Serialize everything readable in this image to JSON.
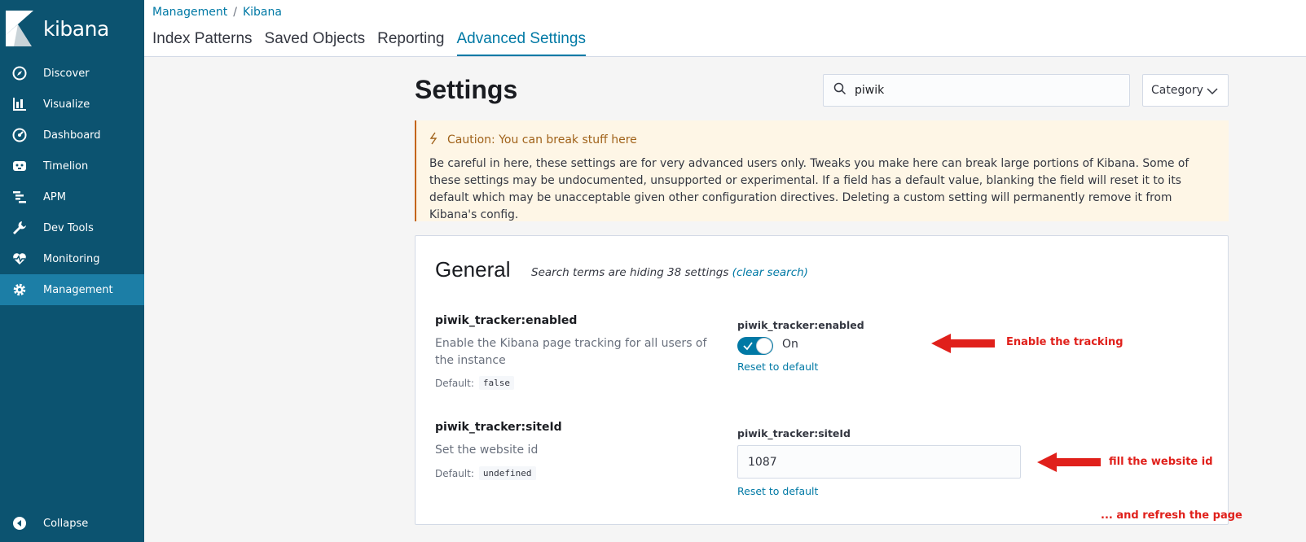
{
  "sidebar": {
    "brand": "kibana",
    "items": [
      {
        "label": "Discover",
        "icon": "compass-icon"
      },
      {
        "label": "Visualize",
        "icon": "bar-chart-icon"
      },
      {
        "label": "Dashboard",
        "icon": "dashboard-icon"
      },
      {
        "label": "Timelion",
        "icon": "timelion-icon"
      },
      {
        "label": "APM",
        "icon": "apm-icon"
      },
      {
        "label": "Dev Tools",
        "icon": "wrench-icon"
      },
      {
        "label": "Monitoring",
        "icon": "heartbeat-icon"
      },
      {
        "label": "Management",
        "icon": "gear-icon",
        "active": true
      }
    ],
    "collapse_label": "Collapse"
  },
  "header": {
    "breadcrumbs": [
      "Management",
      "Kibana"
    ],
    "tabs": [
      {
        "label": "Index Patterns"
      },
      {
        "label": "Saved Objects"
      },
      {
        "label": "Reporting"
      },
      {
        "label": "Advanced Settings",
        "selected": true
      }
    ]
  },
  "main": {
    "title": "Settings",
    "search": {
      "value": "piwik"
    },
    "category_label": "Category",
    "callout": {
      "title": "Caution: You can break stuff here",
      "body": "Be careful in here, these settings are for very advanced users only. Tweaks you make here can break large portions of Kibana. Some of these settings may be undocumented, unsupported or experimental. If a field has a default value, blanking the field will reset it to its default which may be unacceptable given other configuration directives. Deleting a custom setting will permanently remove it from Kibana's config."
    },
    "panel": {
      "title": "General",
      "hint": "Search terms are hiding 38 settings",
      "clear_search": "(clear search)",
      "settings": [
        {
          "name": "piwik_tracker:enabled",
          "description": "Enable the Kibana page tracking for all users of the instance",
          "default_label": "Default:",
          "default_value": "false",
          "field_label": "piwik_tracker:enabled",
          "state_label": "On",
          "reset_label": "Reset to default"
        },
        {
          "name": "piwik_tracker:siteId",
          "description": "Set the website id",
          "default_label": "Default:",
          "default_value": "undefined",
          "field_label": "piwik_tracker:siteId",
          "value": "1087",
          "reset_label": "Reset to default"
        }
      ]
    }
  },
  "annotations": {
    "enable": "Enable the tracking",
    "fill": "fill the website id",
    "refresh": "... and refresh the page",
    "color": "#e0201b"
  }
}
